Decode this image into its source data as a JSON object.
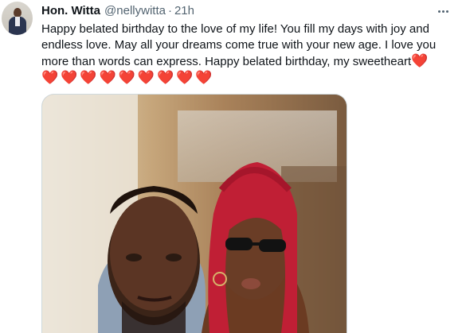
{
  "tweet": {
    "author_name": "Hon. Witta",
    "author_handle": "@nellywitta",
    "separator": "·",
    "timestamp": "21h",
    "lines": [
      "Happy belated birthday to the love of my life! You fill my days with joy and",
      "endless love. May all your dreams come true with your new age.  I love you",
      "more than words can express. Happy belated birthday, my sweetheart"
    ],
    "inline_emoji": "❤️",
    "hearts": [
      "❤️",
      "❤️",
      "❤️",
      "❤️",
      "❤️",
      "❤️",
      "❤️",
      "❤️",
      "❤️"
    ],
    "more_icon": "ellipsis-icon"
  },
  "colors": {
    "text": "#0f1419",
    "secondary": "#536471",
    "heart": "#e0245e"
  }
}
